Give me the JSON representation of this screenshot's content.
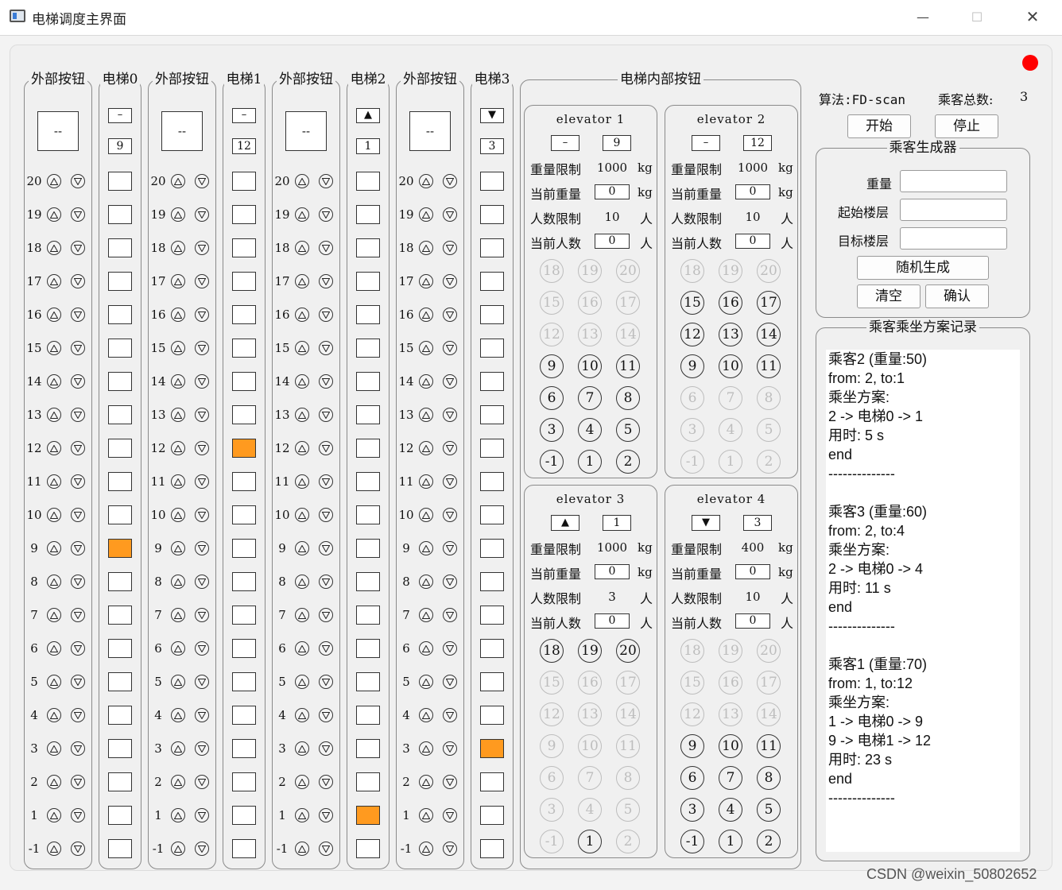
{
  "window": {
    "title": "电梯调度主界面",
    "min": "—",
    "max": "☐",
    "close": "✕"
  },
  "floors": [
    "20",
    "19",
    "18",
    "17",
    "16",
    "15",
    "14",
    "13",
    "12",
    "11",
    "10",
    "9",
    "8",
    "7",
    "6",
    "5",
    "4",
    "3",
    "2",
    "1",
    "-1"
  ],
  "columns": {
    "ext_title": "外部按钮",
    "ext_display": "--",
    "elevators": [
      {
        "title": "电梯0",
        "dir": "–",
        "floor": "9"
      },
      {
        "title": "电梯1",
        "dir": "–",
        "floor": "12"
      },
      {
        "title": "电梯2",
        "dir": "▲",
        "floor": "1"
      },
      {
        "title": "电梯3",
        "dir": "▼",
        "floor": "3"
      }
    ]
  },
  "inner_panel": {
    "title": "电梯内部按钮",
    "labels": {
      "weight_limit": "重量限制",
      "cur_weight": "当前重量",
      "people_limit": "人数限制",
      "cur_people": "当前人数",
      "kg": "kg",
      "person": "人"
    },
    "floor_buttons": [
      "18",
      "19",
      "20",
      "15",
      "16",
      "17",
      "12",
      "13",
      "14",
      "9",
      "10",
      "11",
      "6",
      "7",
      "8",
      "3",
      "4",
      "5",
      "-1",
      "1",
      "2"
    ],
    "elevators": [
      {
        "name": "elevator 1",
        "dir": "–",
        "floor": "9",
        "weight_limit": "1000",
        "cur_weight": "0",
        "people_limit": "10",
        "cur_people": "0",
        "enabled_floors": [
          "9",
          "10",
          "11",
          "6",
          "7",
          "8",
          "3",
          "4",
          "5",
          "-1",
          "1",
          "2"
        ]
      },
      {
        "name": "elevator 2",
        "dir": "–",
        "floor": "12",
        "weight_limit": "1000",
        "cur_weight": "0",
        "people_limit": "10",
        "cur_people": "0",
        "enabled_floors": [
          "15",
          "16",
          "17",
          "12",
          "13",
          "14",
          "9",
          "10",
          "11"
        ]
      },
      {
        "name": "elevator 3",
        "dir": "▲",
        "floor": "1",
        "weight_limit": "1000",
        "cur_weight": "0",
        "people_limit": "3",
        "cur_people": "0",
        "enabled_floors": [
          "18",
          "19",
          "20",
          "1"
        ]
      },
      {
        "name": "elevator 4",
        "dir": "▼",
        "floor": "3",
        "weight_limit": "400",
        "cur_weight": "0",
        "people_limit": "10",
        "cur_people": "0",
        "enabled_floors": [
          "9",
          "10",
          "11",
          "6",
          "7",
          "8",
          "3",
          "4",
          "5",
          "-1",
          "1",
          "2"
        ]
      }
    ]
  },
  "control": {
    "algorithm": "算法:FD-scan",
    "total_label": "乘客总数:",
    "total": "3",
    "start": "开始",
    "stop": "停止"
  },
  "generator": {
    "title": "乘客生成器",
    "weight": "重量",
    "start_floor": "起始楼层",
    "target_floor": "目标楼层",
    "random": "随机生成",
    "clear": "清空",
    "confirm": "确认"
  },
  "log": {
    "title": "乘客乘坐方案记录",
    "lines": [
      "乘客2 (重量:50)",
      "from: 2, to:1",
      "乘坐方案:",
      "2 -> 电梯0 -> 1",
      "用时: 5 s",
      "end",
      "--------------",
      "",
      "乘客3 (重量:60)",
      "from: 2, to:4",
      "乘坐方案:",
      "2 -> 电梯0 -> 4",
      "用时: 11 s",
      "end",
      "--------------",
      "",
      "乘客1 (重量:70)",
      "from: 1, to:12",
      "乘坐方案:",
      "1 -> 电梯0 -> 9",
      "9 -> 电梯1 -> 12",
      "用时: 23 s",
      "end",
      "--------------"
    ]
  },
  "watermark": "CSDN @weixin_50802652",
  "colors": {
    "active_floor": "#ff9a1f",
    "status_dot": "#ff0000"
  }
}
